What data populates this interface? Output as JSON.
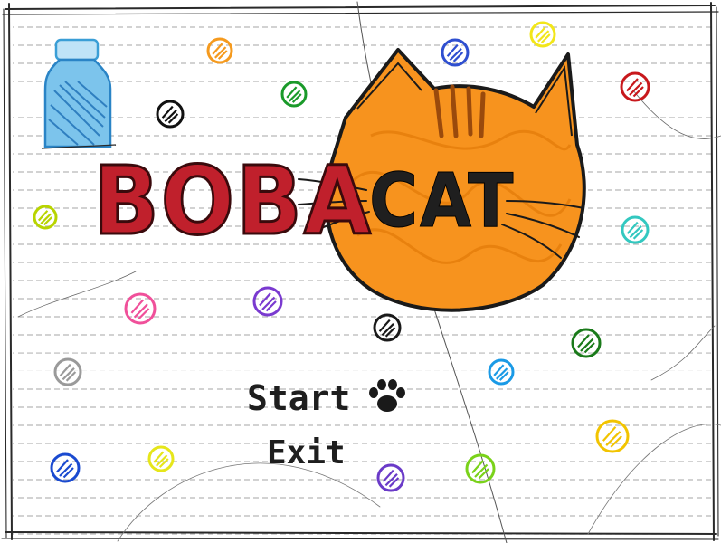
{
  "title": {
    "part1": "BOBA",
    "part2": "CAT"
  },
  "menu": {
    "start_label": "Start",
    "exit_label": "Exit",
    "selected": "Start"
  },
  "colors": {
    "boba_title": "#c0202c",
    "cat_face": "#f7931e",
    "cat_stripes": "#9a4a0c",
    "bottle": "#5ab4e6",
    "ink": "#1a1a1a",
    "paper": "#ffffff",
    "notebook_lines": "#c8c8c8"
  },
  "icons": {
    "bottle": "boba-bottle-icon",
    "cat": "cat-head-icon",
    "cursor": "paw-print-icon"
  },
  "decorations": {
    "boba_colors": [
      "#f59a1e",
      "#2f4fd0",
      "#f2e61a",
      "#c8181c",
      "#1a9a2a",
      "#111111",
      "#33c8c0",
      "#b8d400",
      "#f0509a",
      "#7a3ad0",
      "#1a1a1a",
      "#1a7a1a",
      "#1a9ae6",
      "#9a9a9a",
      "#f2c400",
      "#1a4ad0",
      "#e6e61a",
      "#6a3ac8",
      "#7ad21a"
    ]
  }
}
